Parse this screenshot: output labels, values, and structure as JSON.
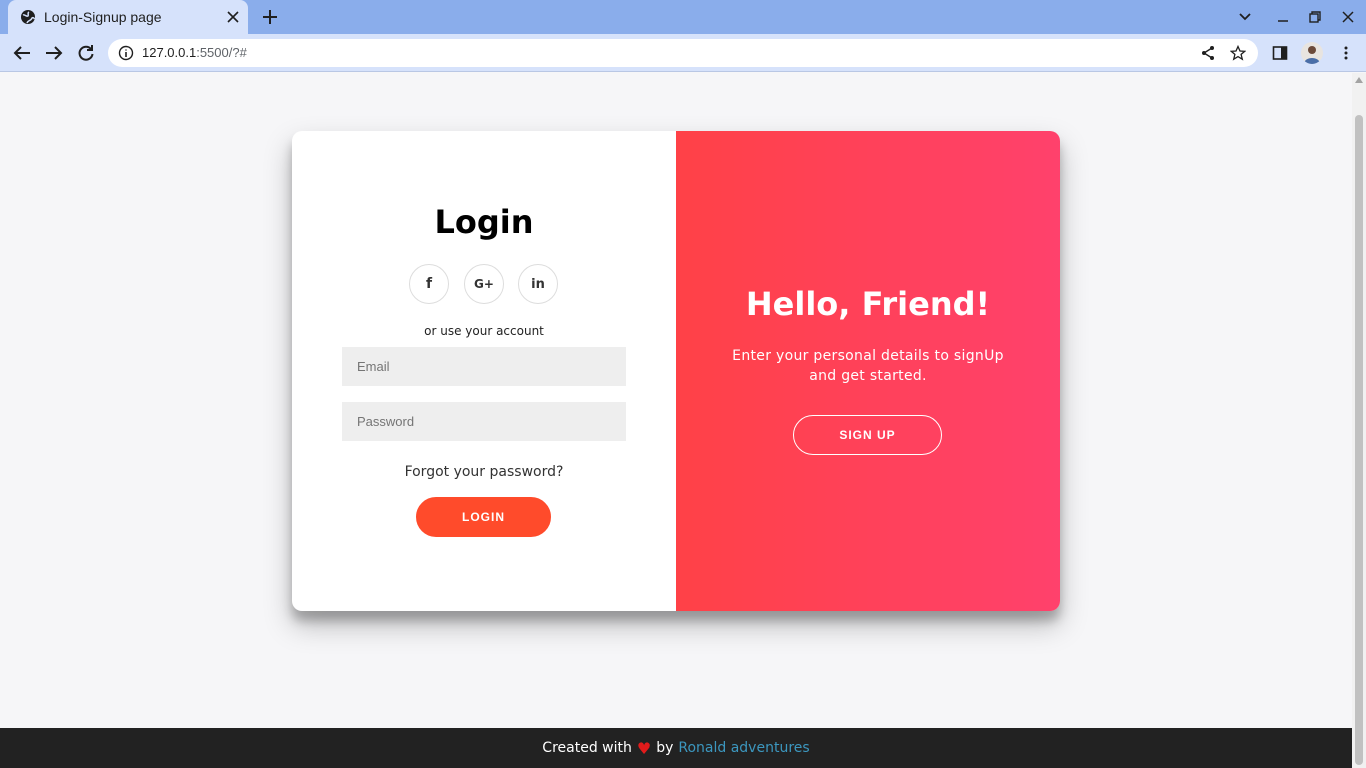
{
  "browser": {
    "tab_title": "Login-Signup page",
    "url_host": "127.0.0.1",
    "url_rest": ":5500/?#"
  },
  "login": {
    "title": "Login",
    "social": [
      {
        "label": "f",
        "icon": "facebook-icon"
      },
      {
        "label": "G+",
        "icon": "google-plus-icon"
      },
      {
        "label": "in",
        "icon": "linkedin-icon"
      }
    ],
    "or_text": "or use your account",
    "email_placeholder": "Email",
    "password_placeholder": "Password",
    "forgot": "Forgot your password?",
    "button": "LOGIN"
  },
  "overlay": {
    "title": "Hello, Friend!",
    "text": "Enter your personal details to signUp and get started.",
    "button": "SIGN UP"
  },
  "footer": {
    "prefix": "Created with",
    "by": "by",
    "author": "Ronald adventures"
  },
  "colors": {
    "accent": "#ff4b2b",
    "gradient_start": "#ff4147",
    "gradient_end": "#ff416c",
    "footer_bg": "#222222",
    "link": "#3c97bf"
  }
}
